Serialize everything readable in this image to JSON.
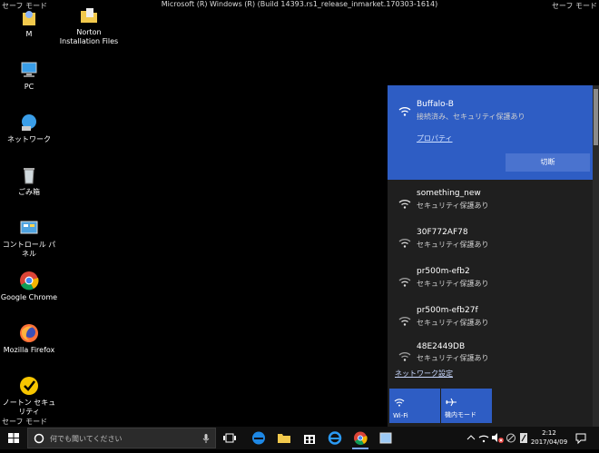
{
  "window": {
    "title": "Microsoft (R) Windows (R) (Build 14393.rs1_release_inmarket.170303-1614)",
    "safe_mode": "セーフ モード"
  },
  "desktop_icons": [
    {
      "label": "M",
      "icon": "user-folder-icon"
    },
    {
      "label": "Norton\nInstallation Files",
      "icon": "folder-icon"
    },
    {
      "label": "PC",
      "icon": "computer-icon"
    },
    {
      "label": "ネットワーク",
      "icon": "network-icon"
    },
    {
      "label": "ごみ箱",
      "icon": "recycle-bin-icon"
    },
    {
      "label": "コントロール パネル",
      "icon": "control-panel-icon"
    },
    {
      "label": "Google Chrome",
      "icon": "chrome-icon"
    },
    {
      "label": "Mozilla Firefox",
      "icon": "firefox-icon"
    },
    {
      "label": "ノートン セキュリティ",
      "icon": "norton-icon"
    }
  ],
  "network": {
    "active": {
      "name": "Buffalo-B",
      "status": "接続済み、セキュリティ保護あり",
      "properties_label": "プロパティ",
      "disconnect_label": "切断"
    },
    "list": [
      {
        "name": "something_new",
        "status": "セキュリティ保護あり"
      },
      {
        "name": "30F772AF78",
        "status": "セキュリティ保護あり"
      },
      {
        "name": "pr500m-efb2",
        "status": "セキュリティ保護あり"
      },
      {
        "name": "pr500m-efb27f",
        "status": "セキュリティ保護あり"
      },
      {
        "name": "48E2449DB",
        "status": "セキュリティ保護あり"
      }
    ],
    "settings_label": "ネットワーク設定",
    "quick_actions": [
      {
        "label": "Wi-Fi",
        "icon": "wifi-icon"
      },
      {
        "label": "機内モード",
        "icon": "airplane-icon"
      }
    ]
  },
  "taskbar": {
    "search_placeholder": "何でも聞いてください",
    "clock_time": "2:12",
    "clock_date": "2017/04/09"
  },
  "colors": {
    "accent": "#2e5dc4",
    "flyout_bg": "#1f1f1f",
    "taskbar_bg": "#101010"
  }
}
